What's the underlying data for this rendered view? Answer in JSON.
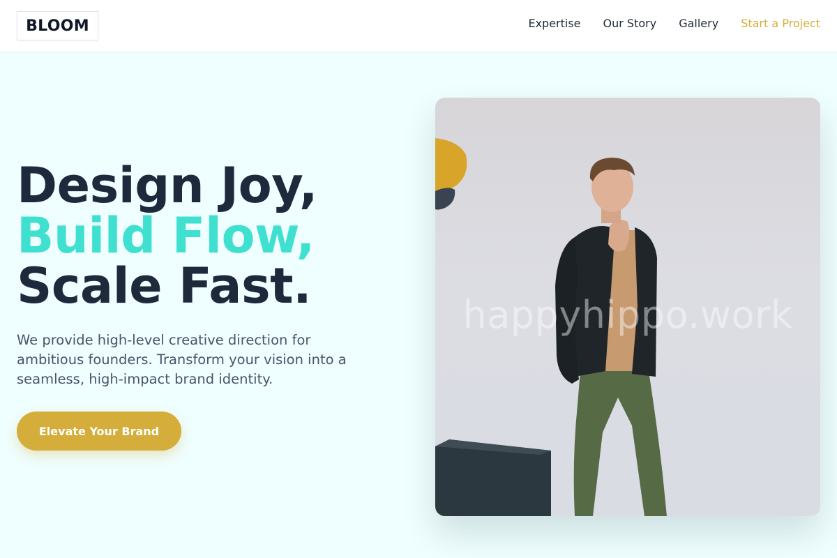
{
  "brand": {
    "logo_text": "BLOOM"
  },
  "nav": {
    "items": [
      {
        "label": "Expertise"
      },
      {
        "label": "Our Story"
      },
      {
        "label": "Gallery"
      }
    ],
    "cta_label": "Start a Project"
  },
  "hero": {
    "headline_line1": "Design Joy,",
    "headline_line2": "Build Flow,",
    "headline_line3": "Scale Fast.",
    "description": "We provide high-level creative direction for ambitious founders. Transform your vision into a seamless, high-impact brand identity.",
    "button_label": "Elevate Your Brand",
    "image_watermark": "happyhippo.work"
  },
  "colors": {
    "accent_teal": "#40e0d0",
    "accent_gold": "#d4ad3a",
    "background": "#effefe",
    "heading": "#1e293b"
  }
}
